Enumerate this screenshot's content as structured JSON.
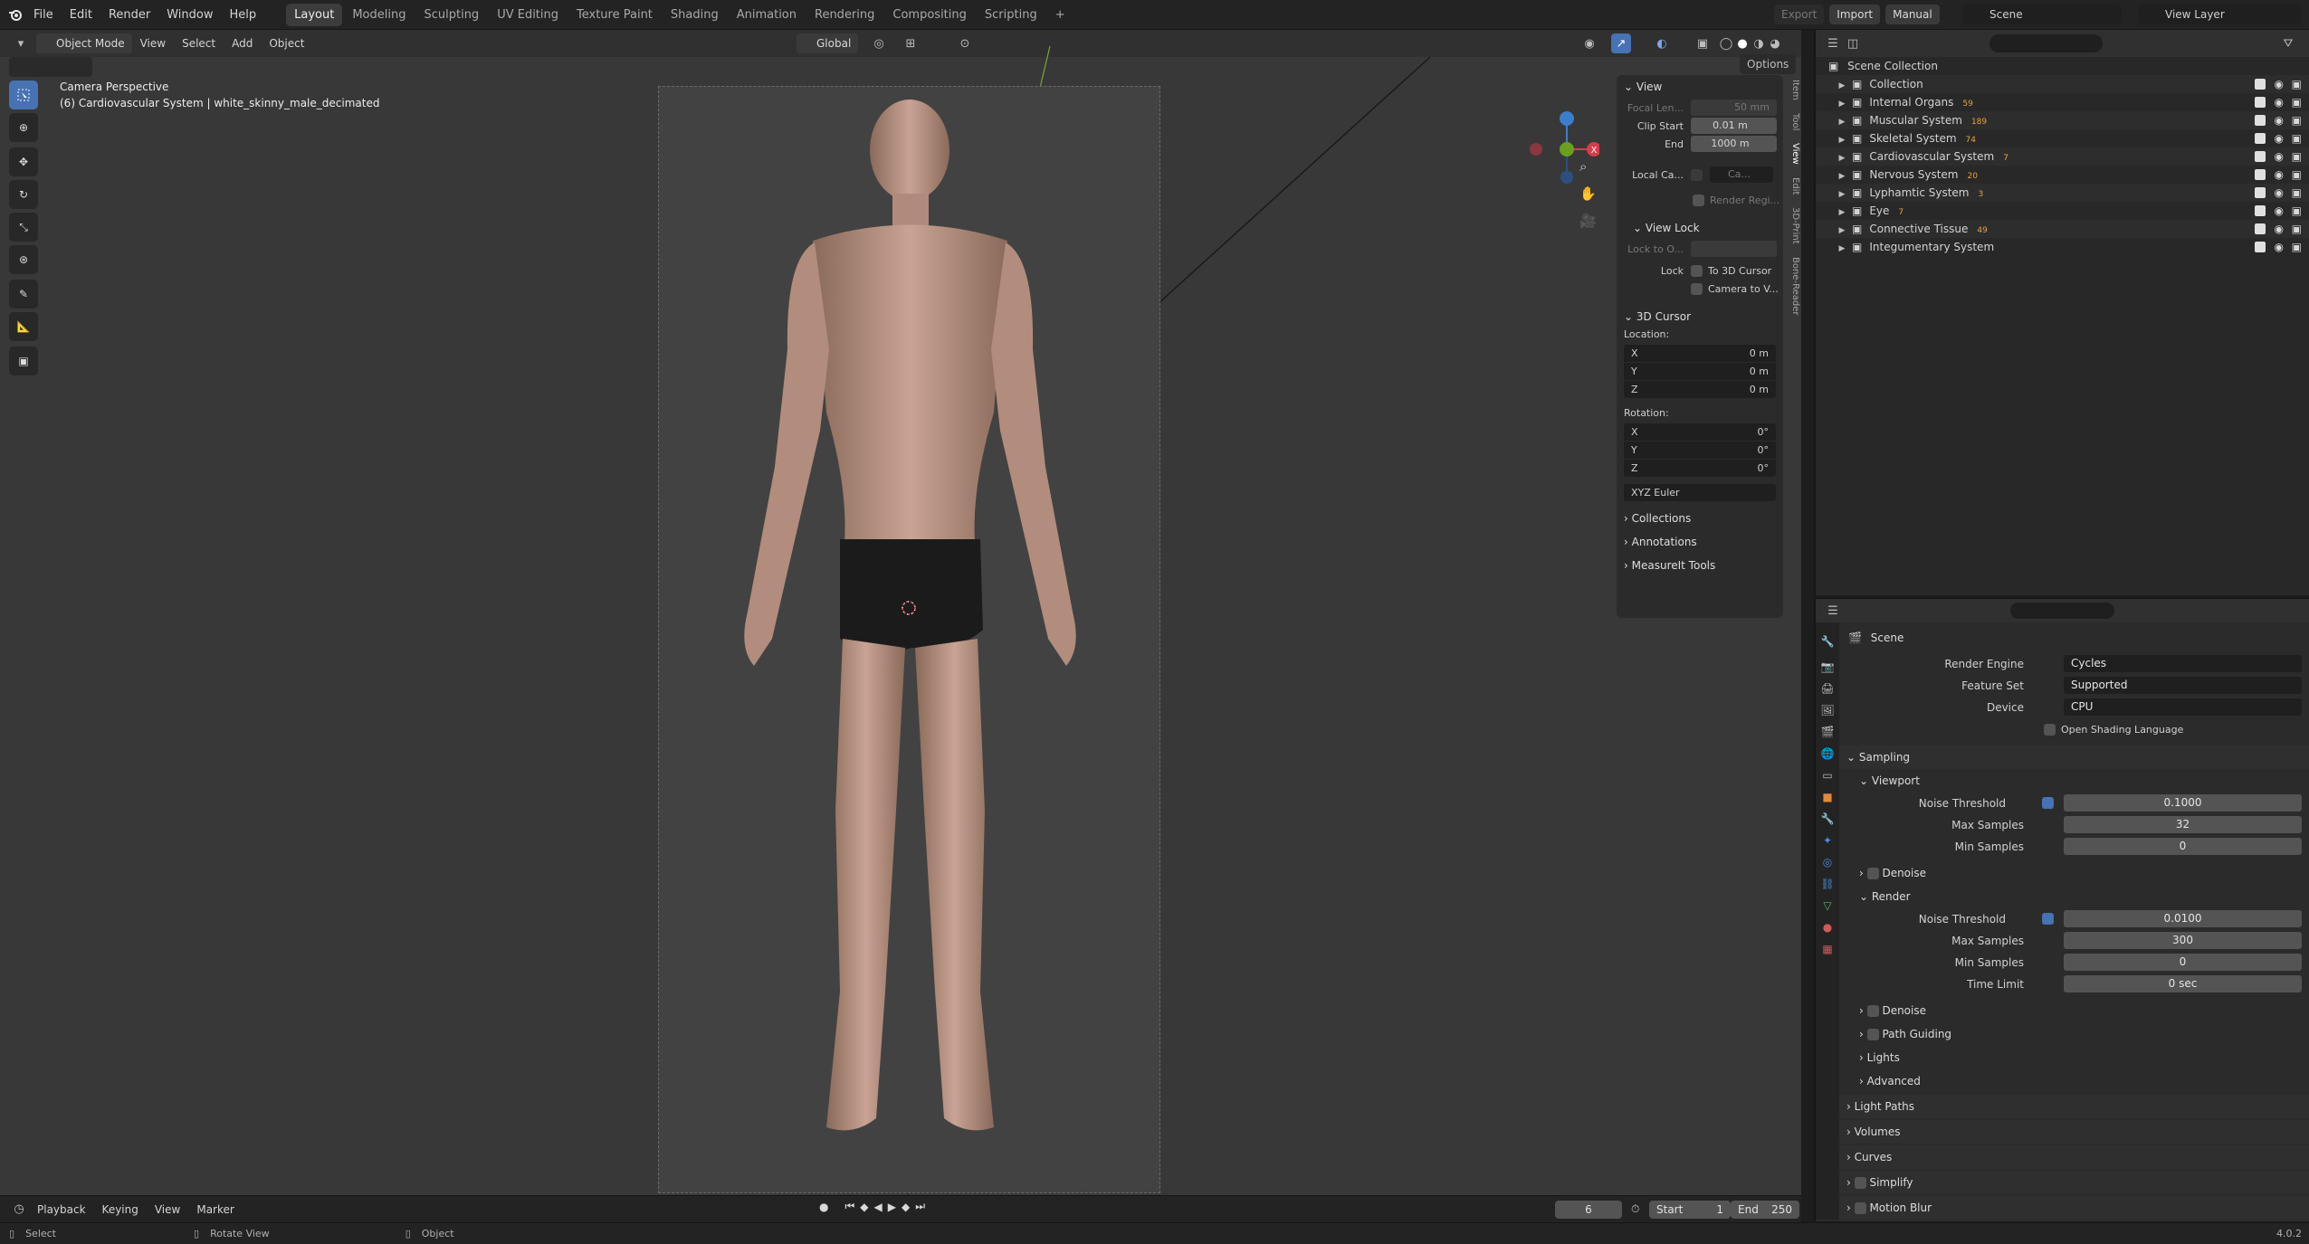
{
  "menu": {
    "items": [
      "File",
      "Edit",
      "Render",
      "Window",
      "Help"
    ],
    "workspaces": [
      "Layout",
      "Modeling",
      "Sculpting",
      "UV Editing",
      "Texture Paint",
      "Shading",
      "Animation",
      "Rendering",
      "Compositing",
      "Scripting"
    ],
    "active_workspace": "Layout",
    "add_tab": "+",
    "export_label": "Export",
    "import_label": "Import",
    "manual_label": "Manual",
    "scene_name": "Scene",
    "view_layer": "View Layer"
  },
  "viewport_header": {
    "mode": "Object Mode",
    "menus": [
      "View",
      "Select",
      "Add",
      "Object"
    ],
    "orientation": "Global",
    "options_label": "Options"
  },
  "viewport": {
    "camera_title": "Camera Perspective",
    "camera_subtitle": "(6) Cardiovascular System | white_skinny_male_decimated",
    "gizmo_x": "X",
    "gizmo_y": "Y",
    "gizmo_z": "Z"
  },
  "npanel": {
    "view_section": "View",
    "focal_label": "Focal Len...",
    "focal_value": "50 mm",
    "clip_start_label": "Clip Start",
    "clip_start_value": "0.01 m",
    "end_label": "End",
    "end_value": "1000 m",
    "local_camera_label": "Local Ca...",
    "local_camera_value": "Ca...",
    "render_region": "Render Regi...",
    "view_lock_section": "View Lock",
    "lock_to_object": "Lock to O...",
    "lock_label": "Lock",
    "to_3d_cursor": "To 3D Cursor",
    "camera_to_view": "Camera to V...",
    "cursor_section": "3D Cursor",
    "location_label": "Location:",
    "loc": [
      {
        "axis": "X",
        "value": "0 m"
      },
      {
        "axis": "Y",
        "value": "0 m"
      },
      {
        "axis": "Z",
        "value": "0 m"
      }
    ],
    "rotation_label": "Rotation:",
    "rot": [
      {
        "axis": "X",
        "value": "0°"
      },
      {
        "axis": "Y",
        "value": "0°"
      },
      {
        "axis": "Z",
        "value": "0°"
      }
    ],
    "rotation_mode": "XYZ Euler",
    "collections": "Collections",
    "annotations": "Annotations",
    "measureit": "MeasureIt Tools",
    "side_tabs": [
      "Item",
      "Tool",
      "View",
      "Edit",
      "3D-Print",
      "Bone-Reader"
    ]
  },
  "outliner": {
    "root": "Scene Collection",
    "rows": [
      {
        "name": "Collection",
        "badge": ""
      },
      {
        "name": "Internal Organs",
        "badge": "59"
      },
      {
        "name": "Muscular System",
        "badge": "189"
      },
      {
        "name": "Skeletal System",
        "badge": "74"
      },
      {
        "name": "Cardiovascular System",
        "badge": "7"
      },
      {
        "name": "Nervous System",
        "badge": "20"
      },
      {
        "name": "Lyphamtic System",
        "badge": "3"
      },
      {
        "name": "Eye",
        "badge": "7"
      },
      {
        "name": "Connective Tissue",
        "badge": "49"
      },
      {
        "name": "Integumentary System",
        "badge": ""
      }
    ]
  },
  "properties": {
    "scene_label": "Scene",
    "render_engine_label": "Render Engine",
    "render_engine": "Cycles",
    "feature_set_label": "Feature Set",
    "feature_set": "Supported",
    "device_label": "Device",
    "device": "CPU",
    "osl_label": "Open Shading Language",
    "sampling": "Sampling",
    "viewport": "Viewport",
    "noise_threshold_label": "Noise Threshold",
    "vp_noise": "0.1000",
    "max_samples_label": "Max Samples",
    "vp_max": "32",
    "min_samples_label": "Min Samples",
    "vp_min": "0",
    "denoise": "Denoise",
    "render": "Render",
    "r_noise": "0.0100",
    "r_max": "300",
    "r_min": "0",
    "time_limit_label": "Time Limit",
    "time_limit": "0 sec",
    "path_guiding": "Path Guiding",
    "lights": "Lights",
    "advanced": "Advanced",
    "light_paths": "Light Paths",
    "volumes": "Volumes",
    "curves": "Curves",
    "simplify": "Simplify",
    "motion_blur": "Motion Blur"
  },
  "timeline": {
    "menus": [
      "Playback",
      "Keying",
      "View",
      "Marker"
    ],
    "current_frame": "6",
    "start_label": "Start",
    "start": "1",
    "end_label": "End",
    "end": "250"
  },
  "status": {
    "select": "Select",
    "rotate": "Rotate View",
    "object": "Object",
    "version": "4.0.2"
  },
  "colors": {
    "accent": "#4772b3",
    "axis_x": "#d63c4c",
    "axis_y": "#6a9f1f",
    "axis_z": "#3d7ecc"
  }
}
